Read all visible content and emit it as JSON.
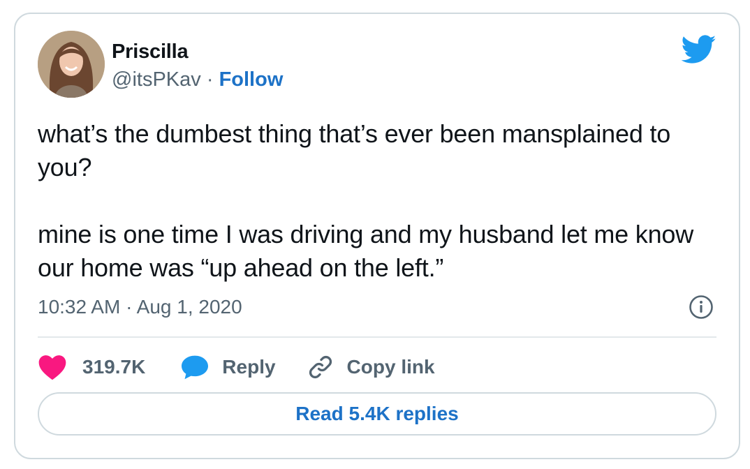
{
  "author": {
    "name": "Priscilla",
    "handle": "@itsPKav",
    "separator": "·",
    "follow_label": "Follow"
  },
  "tweet": {
    "paragraphs": [
      "what’s the dumbest thing that’s ever been mansplained to you?",
      "mine is one time I was driving and my husband let me know our home was “up ahead on the left.”"
    ],
    "time": "10:32 AM",
    "meta_separator": "·",
    "date": "Aug 1, 2020"
  },
  "actions": {
    "like_count": "319.7K",
    "reply_label": "Reply",
    "copy_link_label": "Copy link"
  },
  "read_replies_label": "Read 5.4K replies",
  "icons": {
    "brand": "twitter-bird-icon",
    "info": "info-icon",
    "like": "heart-icon",
    "reply": "speech-bubble-icon",
    "copy": "link-icon"
  },
  "colors": {
    "twitter_blue": "#1d9bf0",
    "link_blue": "#1d72c7",
    "like_pink": "#f91880",
    "secondary_text": "#536471",
    "border": "#cfd9de"
  }
}
